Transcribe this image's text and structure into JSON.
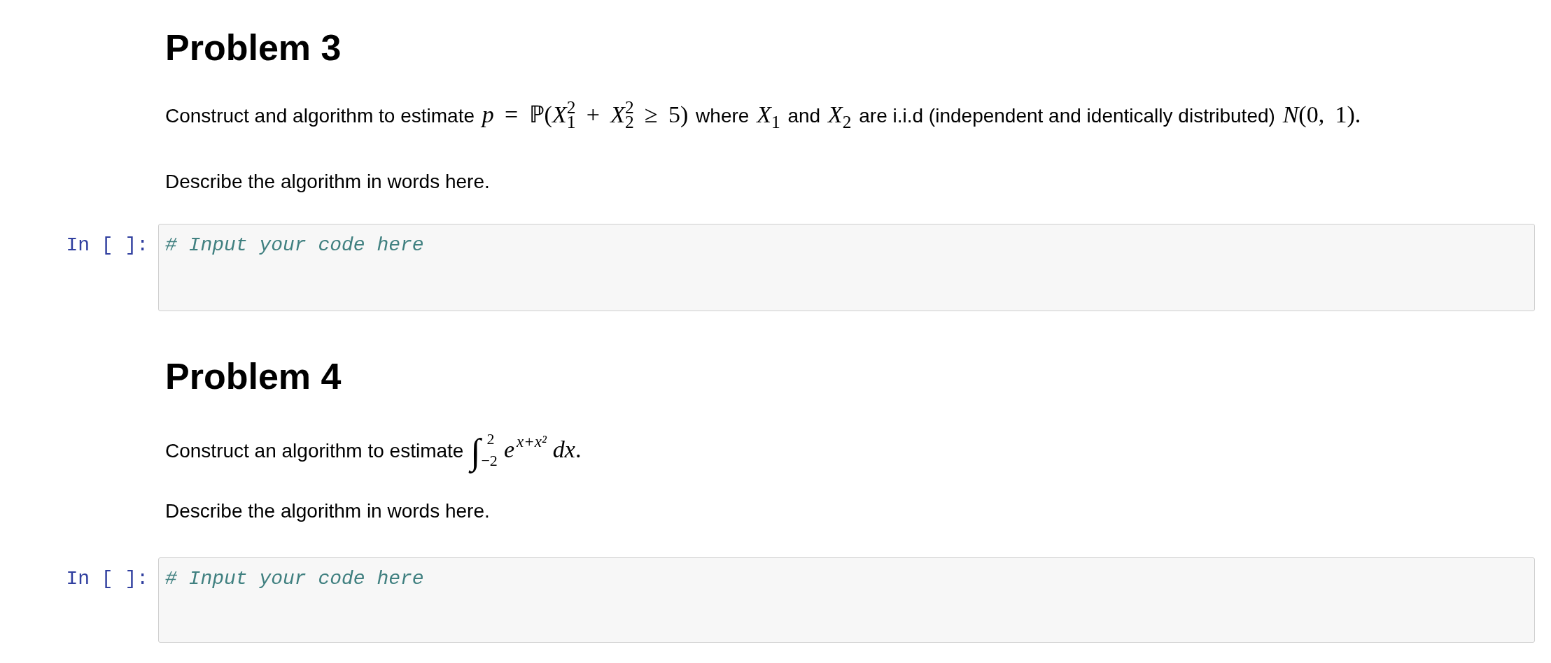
{
  "cells": [
    {
      "kind": "markdown",
      "heading": "Problem 3",
      "paragraphs": [
        {
          "segments": [
            {
              "kind": "text",
              "text": "Construct and algorithm to estimate "
            },
            {
              "kind": "math",
              "text": "*p* = ℙ(*X*$_{1}$$^{2}$ + *X*$_{2}$$^{2}$ ≥ 5)"
            },
            {
              "kind": "text",
              "text": " where "
            },
            {
              "kind": "math",
              "text": "*X*$_{1}$"
            },
            {
              "kind": "text",
              "text": " and "
            },
            {
              "kind": "math",
              "text": "*X*$_{2}$"
            },
            {
              "kind": "text",
              "text": " are i.i.d (independent and identically distributed) "
            },
            {
              "kind": "math",
              "text": "*N*(0, 1)."
            }
          ]
        },
        {
          "segments": [
            {
              "kind": "text",
              "text": "Describe the algorithm in words here."
            }
          ]
        }
      ]
    },
    {
      "kind": "code",
      "prompt": "In [ ]:",
      "code": "# Input your code here"
    },
    {
      "kind": "markdown",
      "heading": "Problem 4",
      "paragraphs": [
        {
          "segments": [
            {
              "kind": "text",
              "text": "Construct an algorithm to estimate "
            },
            {
              "kind": "integral",
              "symbol": "∫",
              "lower": "−2",
              "upper": "2"
            },
            {
              "kind": "math",
              "text": "*e*"
            },
            {
              "kind": "exponent",
              "text": "x+x²"
            },
            {
              "kind": "math",
              "text": "*dx*."
            }
          ]
        },
        {
          "segments": [
            {
              "kind": "text",
              "text": "Describe the algorithm in words here."
            }
          ]
        }
      ]
    },
    {
      "kind": "code",
      "prompt": "In [ ]:",
      "code": "# Input your code here"
    }
  ]
}
